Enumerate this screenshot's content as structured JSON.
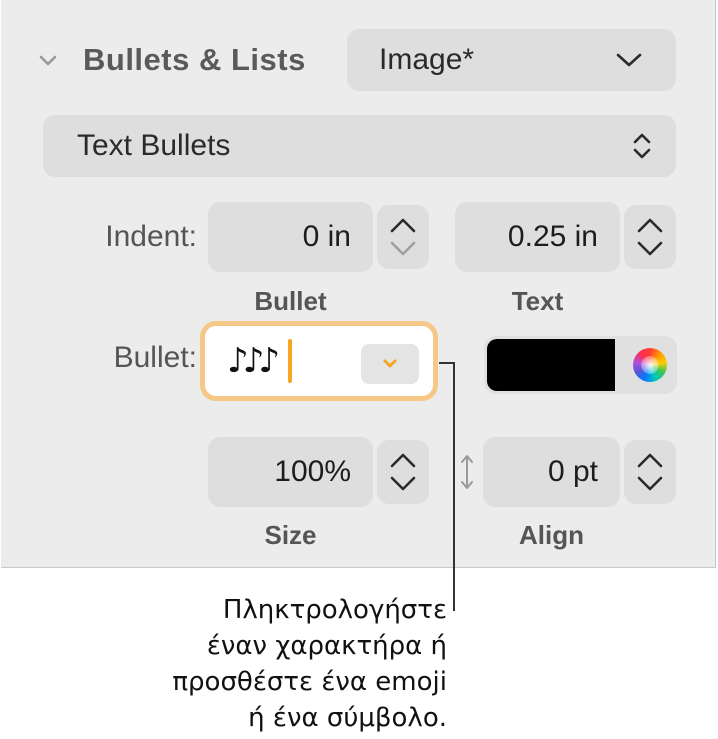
{
  "section": {
    "title": "Bullets & Lists",
    "disclosure_icon": "chevron-down-icon"
  },
  "list_style_popup": {
    "value": "Image*"
  },
  "bullet_type_popup": {
    "value": "Text Bullets"
  },
  "indent": {
    "label": "Indent:",
    "bullet_value": "0 in",
    "bullet_label": "Bullet",
    "text_value": "0.25 in",
    "text_label": "Text"
  },
  "bullet": {
    "label": "Bullet:",
    "value": "♪♪♪",
    "color": "#000000",
    "focus_color": "#f6c887",
    "accent_color": "#f5a623"
  },
  "size": {
    "value": "100%",
    "label": "Size"
  },
  "align": {
    "value": "0 pt",
    "label": "Align"
  },
  "callout": {
    "lines": [
      "Πληκτρολογήστε",
      "έναν χαρακτήρα ή",
      "προσθέστε ένα emoji",
      "ή ένα σύμβολο."
    ]
  }
}
